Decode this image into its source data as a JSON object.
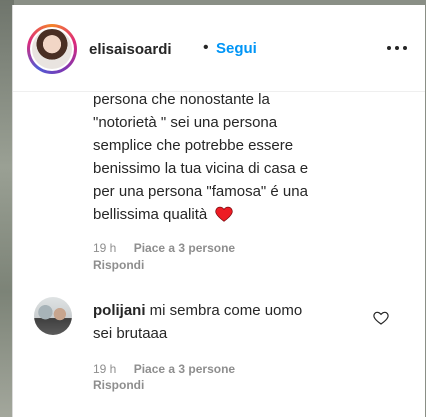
{
  "header": {
    "username": "elisaisoardi",
    "dot": "•",
    "follow_label": "Segui"
  },
  "comments": [
    {
      "lines": [
        "persona che nonostante la",
        "\"notorietà \" sei una persona",
        "semplice che potrebbe essere",
        "benissimo la tua vicina di casa e",
        "per una persona \"famosa\" é una",
        "bellissima qualità"
      ],
      "time": "19 h",
      "likes": "Piace a 3 persone",
      "reply": "Rispondi"
    },
    {
      "author": "polijani",
      "text_line1": "mi sembra come uomo",
      "text_line2": "sei brutaaa",
      "time": "19 h",
      "likes": "Piace a 3 persone",
      "reply": "Rispondi"
    }
  ],
  "icons": {
    "heart_emoji": "red-heart-emoji",
    "like": "heart-outline-icon",
    "more": "more-options-icon"
  },
  "colors": {
    "link": "#0095f6",
    "heart": "#ed1c24",
    "text": "#262626",
    "muted": "#8e8e8e"
  }
}
